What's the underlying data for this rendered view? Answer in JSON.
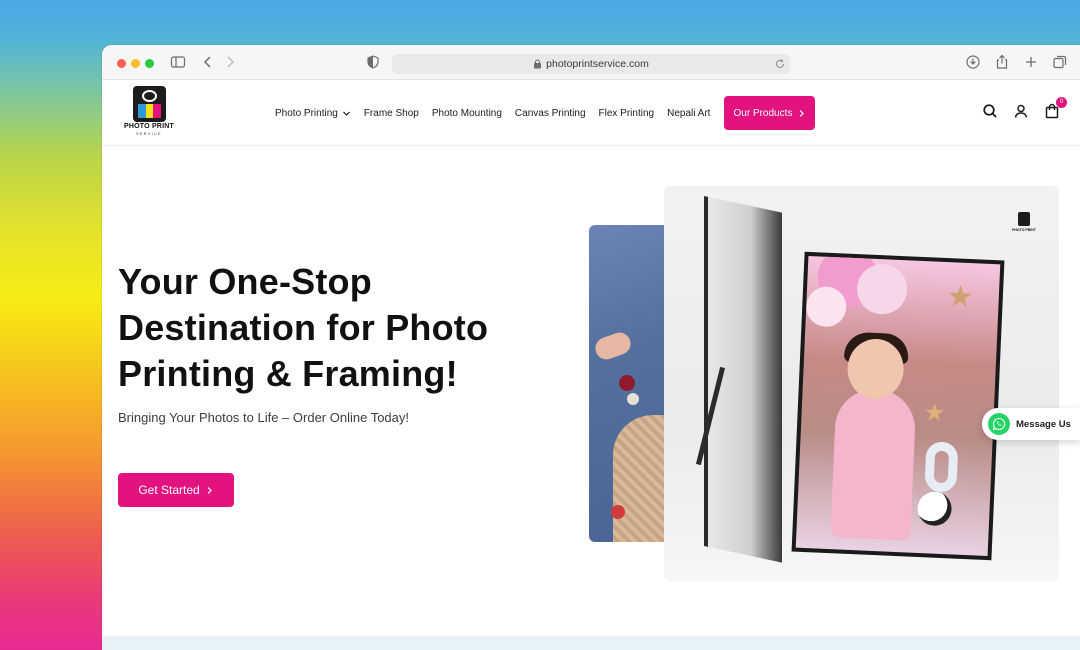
{
  "browser": {
    "url": "photoprintservice.com"
  },
  "site": {
    "logo_text": "PHOTO PRINT",
    "logo_subtext": "SERVICE",
    "nav": [
      {
        "label": "Photo Printing",
        "has_dropdown": true
      },
      {
        "label": "Frame Shop"
      },
      {
        "label": "Photo Mounting"
      },
      {
        "label": "Canvas Printing"
      },
      {
        "label": "Flex Printing"
      },
      {
        "label": "Nepali Art"
      }
    ],
    "cta_label": "Our Products",
    "cart_count": "0"
  },
  "hero": {
    "title": "Your One-Stop Destination for Photo Printing & Framing!",
    "subtitle": "Bringing Your Photos to Life – Order Online Today!",
    "button_label": "Get Started",
    "watermark_text": "PHOTO PRINT"
  },
  "chat": {
    "label": "Message Us"
  },
  "colors": {
    "accent": "#e2137f",
    "whatsapp": "#25d366"
  }
}
